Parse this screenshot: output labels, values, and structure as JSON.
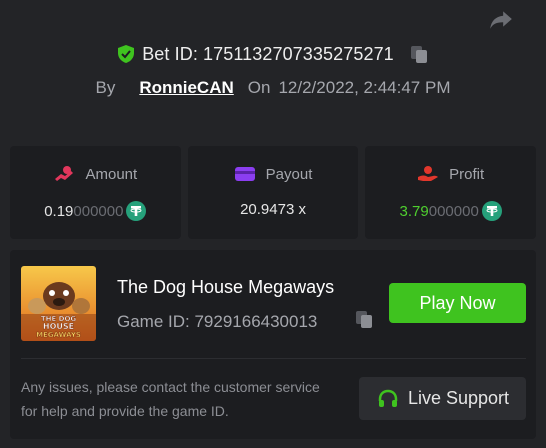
{
  "header": {
    "bet_label": "Bet ID: 1751132707335275271",
    "by_label": "By",
    "username": "RonnieCAN",
    "on_label": "On",
    "date": "12/2/2022, 2:44:47 PM"
  },
  "stats": {
    "amount": {
      "label": "Amount",
      "value_main": "0.19",
      "value_dim": "000000",
      "coin": "usdt-icon"
    },
    "payout": {
      "label": "Payout",
      "value": "20.9473 x"
    },
    "profit": {
      "label": "Profit",
      "value_main": "3.79",
      "value_dim": "000000",
      "coin": "usdt-icon"
    }
  },
  "game": {
    "title": "The Dog House Megaways",
    "id_label": "Game ID: 7929166430013",
    "thumb_text_1": "THE DOG",
    "thumb_text_2": "HOUSE",
    "thumb_text_3": "MEGAWAYS",
    "play_label": "Play Now"
  },
  "support": {
    "note": "Any issues, please contact the customer service for help and provide the game ID.",
    "button_label": "Live Support"
  },
  "colors": {
    "accent_green": "#3fc31f",
    "profit_green": "#4fcf2f",
    "amount_icon": "#e2375c",
    "payout_icon": "#8b3ef0",
    "profit_icon": "#e2372c",
    "coin_teal": "#26a17b"
  }
}
